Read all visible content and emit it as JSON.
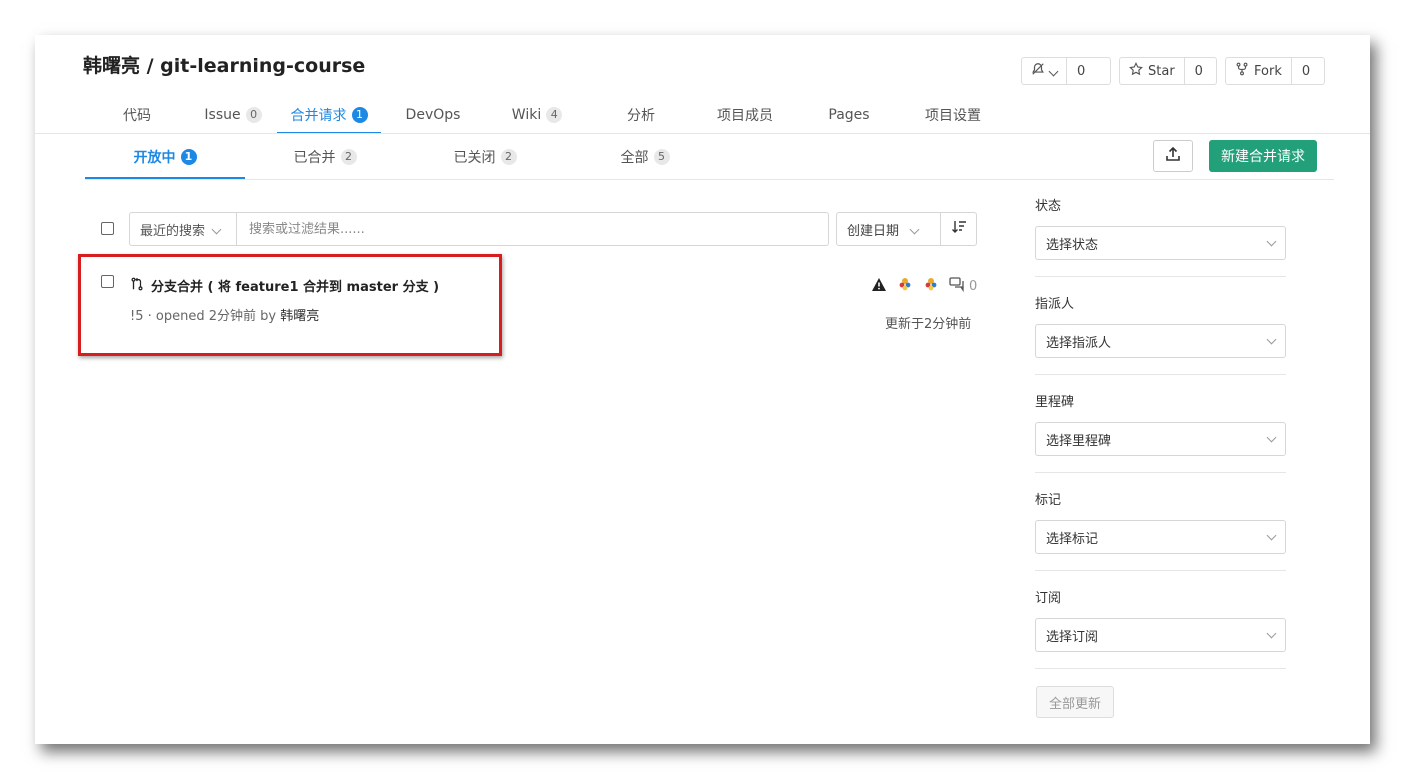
{
  "repo": {
    "title": "韩曙亮 / git-learning-course"
  },
  "actions": {
    "watch": {
      "count": "0"
    },
    "star": {
      "label": "Star",
      "count": "0"
    },
    "fork": {
      "label": "Fork",
      "count": "0"
    }
  },
  "nav": [
    {
      "label": "代码"
    },
    {
      "label": "Issue",
      "badge": "0"
    },
    {
      "label": "合并请求",
      "badge": "1"
    },
    {
      "label": "DevOps"
    },
    {
      "label": "Wiki",
      "badge": "4"
    },
    {
      "label": "分析"
    },
    {
      "label": "项目成员"
    },
    {
      "label": "Pages"
    },
    {
      "label": "项目设置"
    }
  ],
  "tabs": [
    {
      "label": "开放中",
      "badge": "1"
    },
    {
      "label": "已合并",
      "badge": "2"
    },
    {
      "label": "已关闭",
      "badge": "2"
    },
    {
      "label": "全部",
      "badge": "5"
    }
  ],
  "toolbar": {
    "new_label": "新建合并请求"
  },
  "filter": {
    "recent_label": "最近的搜索",
    "search_placeholder": "搜索或过滤结果......",
    "sort_label": "创建日期"
  },
  "merge_request": {
    "title": "分支合并 ( 将 feature1 合并到 master 分支 )",
    "meta_prefix": "!5 · opened 2分钟前 by ",
    "author": "韩曙亮",
    "comments": "0",
    "updated": "更新于2分钟前"
  },
  "sidebar": {
    "sections": [
      {
        "label": "状态",
        "placeholder": "选择状态"
      },
      {
        "label": "指派人",
        "placeholder": "选择指派人"
      },
      {
        "label": "里程碑",
        "placeholder": "选择里程碑"
      },
      {
        "label": "标记",
        "placeholder": "选择标记"
      },
      {
        "label": "订阅",
        "placeholder": "选择订阅"
      }
    ],
    "update_all_label": "全部更新"
  },
  "colors": {
    "accent": "#1e88e5",
    "primary_button": "#21a07a",
    "highlight": "#d81d1d"
  }
}
